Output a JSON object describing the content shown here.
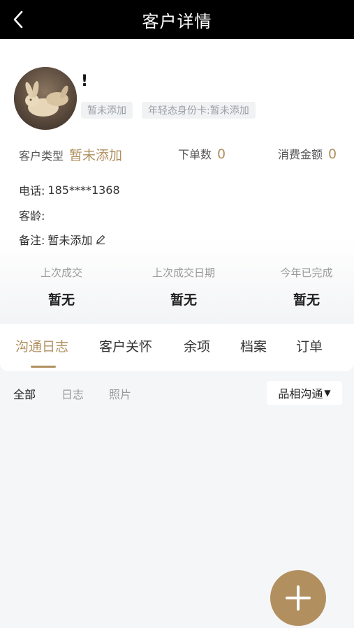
{
  "header": {
    "title": "客户详情",
    "back_icon": "chevron-left-icon"
  },
  "profile": {
    "avatar_icon": "rabbit-avatar-image",
    "name": "!",
    "tags": [
      "暂未添加",
      "年轻态身份卡:暂未添加"
    ],
    "stats": {
      "type_label": "客户类型",
      "type_value": "暂未添加",
      "orders_label": "下单数",
      "orders_value": "0",
      "amount_label": "消费金额",
      "amount_value": "0"
    },
    "phone_label": "电话:",
    "phone_value": "185****1368",
    "age_label": "客龄:",
    "age_value": "",
    "note_label": "备注:",
    "note_value": "暂未添加",
    "summary": [
      {
        "label": "上次成交",
        "value": "暂无"
      },
      {
        "label": "上次成交日期",
        "value": "暂无"
      },
      {
        "label": "今年已完成",
        "value": "暂无"
      }
    ]
  },
  "tabs": [
    "沟通日志",
    "客户关怀",
    "余项",
    "档案",
    "订单"
  ],
  "filters": [
    "全部",
    "日志",
    "照片"
  ],
  "dropdown": {
    "selected": "品相沟通",
    "caret": "▼"
  },
  "fab": {
    "icon": "plus-icon"
  },
  "colors": {
    "accent": "#b0905e",
    "header_bg": "#000000",
    "fab_bg": "#b28f5f"
  }
}
